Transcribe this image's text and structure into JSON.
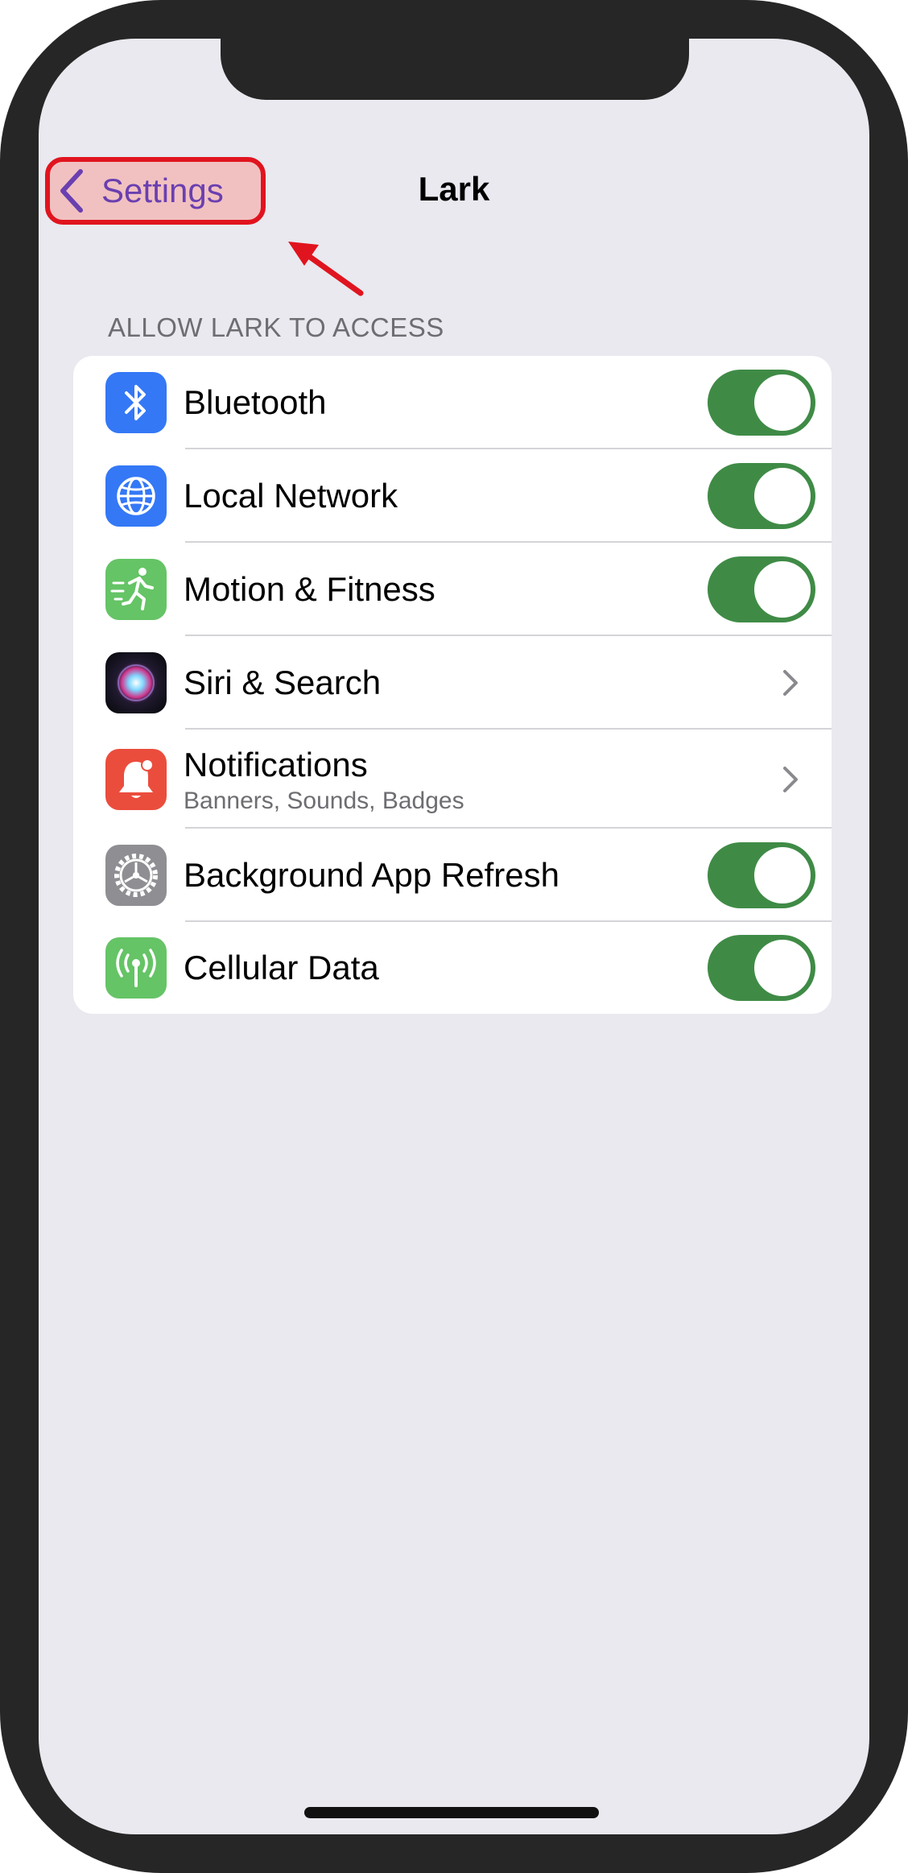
{
  "nav": {
    "back_label": "Settings",
    "title": "Lark"
  },
  "section_header": "ALLOW LARK TO ACCESS",
  "rows": [
    {
      "label": "Bluetooth",
      "icon": "bluetooth-icon",
      "icon_color": "#3478f6",
      "control": "toggle",
      "on": true
    },
    {
      "label": "Local Network",
      "icon": "globe-icon",
      "icon_color": "#3478f6",
      "control": "toggle",
      "on": true
    },
    {
      "label": "Motion & Fitness",
      "icon": "running-figure-icon",
      "icon_color": "#65c466",
      "control": "toggle",
      "on": true
    },
    {
      "label": "Siri & Search",
      "icon": "siri-icon",
      "icon_color": "#1a1a2e",
      "control": "chevron"
    },
    {
      "label": "Notifications",
      "sublabel": "Banners, Sounds, Badges",
      "icon": "bell-icon",
      "icon_color": "#eb4d3d",
      "control": "chevron"
    },
    {
      "label": "Background App Refresh",
      "icon": "gear-icon",
      "icon_color": "#8e8e93",
      "control": "toggle",
      "on": true
    },
    {
      "label": "Cellular Data",
      "icon": "antenna-icon",
      "icon_color": "#65c466",
      "control": "toggle",
      "on": true
    }
  ],
  "colors": {
    "toggle_on": "#3f8b46",
    "highlight_border": "#e0141e",
    "highlight_fill": "#f1c1c1",
    "back_text": "#6a3fb0"
  }
}
